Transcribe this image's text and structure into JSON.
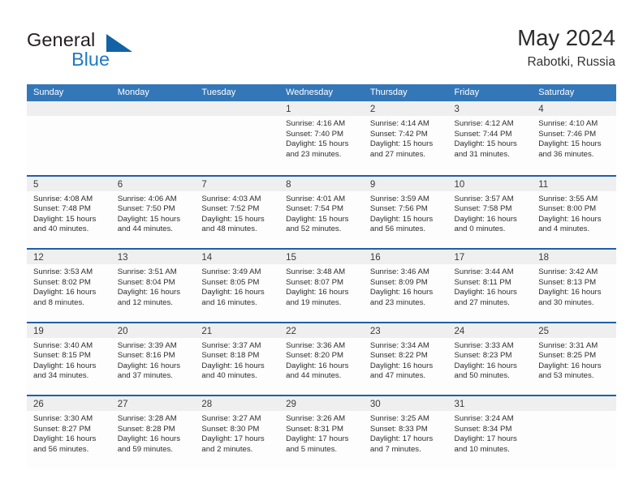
{
  "brand": {
    "word1": "General",
    "word2": "Blue",
    "triangle_color": "#1263a5",
    "blue_color": "#1f7ac4"
  },
  "header": {
    "title": "May 2024",
    "subtitle": "Rabotki, Russia",
    "header_bg": "#3477b8",
    "week_rule": "#1f5fa8",
    "numstrip_bg": "#efefef"
  },
  "weekday_headers": [
    "Sunday",
    "Monday",
    "Tuesday",
    "Wednesday",
    "Thursday",
    "Friday",
    "Saturday"
  ],
  "labels": {
    "sunrise": "Sunrise:",
    "sunset": "Sunset:",
    "daylight": "Daylight:"
  },
  "weeks": [
    [
      {
        "day": "",
        "sunrise": "",
        "sunset": "",
        "daylight": ""
      },
      {
        "day": "",
        "sunrise": "",
        "sunset": "",
        "daylight": ""
      },
      {
        "day": "",
        "sunrise": "",
        "sunset": "",
        "daylight": ""
      },
      {
        "day": "1",
        "sunrise": "Sunrise: 4:16 AM",
        "sunset": "Sunset: 7:40 PM",
        "daylight": "Daylight: 15 hours and 23 minutes."
      },
      {
        "day": "2",
        "sunrise": "Sunrise: 4:14 AM",
        "sunset": "Sunset: 7:42 PM",
        "daylight": "Daylight: 15 hours and 27 minutes."
      },
      {
        "day": "3",
        "sunrise": "Sunrise: 4:12 AM",
        "sunset": "Sunset: 7:44 PM",
        "daylight": "Daylight: 15 hours and 31 minutes."
      },
      {
        "day": "4",
        "sunrise": "Sunrise: 4:10 AM",
        "sunset": "Sunset: 7:46 PM",
        "daylight": "Daylight: 15 hours and 36 minutes."
      }
    ],
    [
      {
        "day": "5",
        "sunrise": "Sunrise: 4:08 AM",
        "sunset": "Sunset: 7:48 PM",
        "daylight": "Daylight: 15 hours and 40 minutes."
      },
      {
        "day": "6",
        "sunrise": "Sunrise: 4:06 AM",
        "sunset": "Sunset: 7:50 PM",
        "daylight": "Daylight: 15 hours and 44 minutes."
      },
      {
        "day": "7",
        "sunrise": "Sunrise: 4:03 AM",
        "sunset": "Sunset: 7:52 PM",
        "daylight": "Daylight: 15 hours and 48 minutes."
      },
      {
        "day": "8",
        "sunrise": "Sunrise: 4:01 AM",
        "sunset": "Sunset: 7:54 PM",
        "daylight": "Daylight: 15 hours and 52 minutes."
      },
      {
        "day": "9",
        "sunrise": "Sunrise: 3:59 AM",
        "sunset": "Sunset: 7:56 PM",
        "daylight": "Daylight: 15 hours and 56 minutes."
      },
      {
        "day": "10",
        "sunrise": "Sunrise: 3:57 AM",
        "sunset": "Sunset: 7:58 PM",
        "daylight": "Daylight: 16 hours and 0 minutes."
      },
      {
        "day": "11",
        "sunrise": "Sunrise: 3:55 AM",
        "sunset": "Sunset: 8:00 PM",
        "daylight": "Daylight: 16 hours and 4 minutes."
      }
    ],
    [
      {
        "day": "12",
        "sunrise": "Sunrise: 3:53 AM",
        "sunset": "Sunset: 8:02 PM",
        "daylight": "Daylight: 16 hours and 8 minutes."
      },
      {
        "day": "13",
        "sunrise": "Sunrise: 3:51 AM",
        "sunset": "Sunset: 8:04 PM",
        "daylight": "Daylight: 16 hours and 12 minutes."
      },
      {
        "day": "14",
        "sunrise": "Sunrise: 3:49 AM",
        "sunset": "Sunset: 8:05 PM",
        "daylight": "Daylight: 16 hours and 16 minutes."
      },
      {
        "day": "15",
        "sunrise": "Sunrise: 3:48 AM",
        "sunset": "Sunset: 8:07 PM",
        "daylight": "Daylight: 16 hours and 19 minutes."
      },
      {
        "day": "16",
        "sunrise": "Sunrise: 3:46 AM",
        "sunset": "Sunset: 8:09 PM",
        "daylight": "Daylight: 16 hours and 23 minutes."
      },
      {
        "day": "17",
        "sunrise": "Sunrise: 3:44 AM",
        "sunset": "Sunset: 8:11 PM",
        "daylight": "Daylight: 16 hours and 27 minutes."
      },
      {
        "day": "18",
        "sunrise": "Sunrise: 3:42 AM",
        "sunset": "Sunset: 8:13 PM",
        "daylight": "Daylight: 16 hours and 30 minutes."
      }
    ],
    [
      {
        "day": "19",
        "sunrise": "Sunrise: 3:40 AM",
        "sunset": "Sunset: 8:15 PM",
        "daylight": "Daylight: 16 hours and 34 minutes."
      },
      {
        "day": "20",
        "sunrise": "Sunrise: 3:39 AM",
        "sunset": "Sunset: 8:16 PM",
        "daylight": "Daylight: 16 hours and 37 minutes."
      },
      {
        "day": "21",
        "sunrise": "Sunrise: 3:37 AM",
        "sunset": "Sunset: 8:18 PM",
        "daylight": "Daylight: 16 hours and 40 minutes."
      },
      {
        "day": "22",
        "sunrise": "Sunrise: 3:36 AM",
        "sunset": "Sunset: 8:20 PM",
        "daylight": "Daylight: 16 hours and 44 minutes."
      },
      {
        "day": "23",
        "sunrise": "Sunrise: 3:34 AM",
        "sunset": "Sunset: 8:22 PM",
        "daylight": "Daylight: 16 hours and 47 minutes."
      },
      {
        "day": "24",
        "sunrise": "Sunrise: 3:33 AM",
        "sunset": "Sunset: 8:23 PM",
        "daylight": "Daylight: 16 hours and 50 minutes."
      },
      {
        "day": "25",
        "sunrise": "Sunrise: 3:31 AM",
        "sunset": "Sunset: 8:25 PM",
        "daylight": "Daylight: 16 hours and 53 minutes."
      }
    ],
    [
      {
        "day": "26",
        "sunrise": "Sunrise: 3:30 AM",
        "sunset": "Sunset: 8:27 PM",
        "daylight": "Daylight: 16 hours and 56 minutes."
      },
      {
        "day": "27",
        "sunrise": "Sunrise: 3:28 AM",
        "sunset": "Sunset: 8:28 PM",
        "daylight": "Daylight: 16 hours and 59 minutes."
      },
      {
        "day": "28",
        "sunrise": "Sunrise: 3:27 AM",
        "sunset": "Sunset: 8:30 PM",
        "daylight": "Daylight: 17 hours and 2 minutes."
      },
      {
        "day": "29",
        "sunrise": "Sunrise: 3:26 AM",
        "sunset": "Sunset: 8:31 PM",
        "daylight": "Daylight: 17 hours and 5 minutes."
      },
      {
        "day": "30",
        "sunrise": "Sunrise: 3:25 AM",
        "sunset": "Sunset: 8:33 PM",
        "daylight": "Daylight: 17 hours and 7 minutes."
      },
      {
        "day": "31",
        "sunrise": "Sunrise: 3:24 AM",
        "sunset": "Sunset: 8:34 PM",
        "daylight": "Daylight: 17 hours and 10 minutes."
      },
      {
        "day": "",
        "sunrise": "",
        "sunset": "",
        "daylight": ""
      }
    ]
  ]
}
